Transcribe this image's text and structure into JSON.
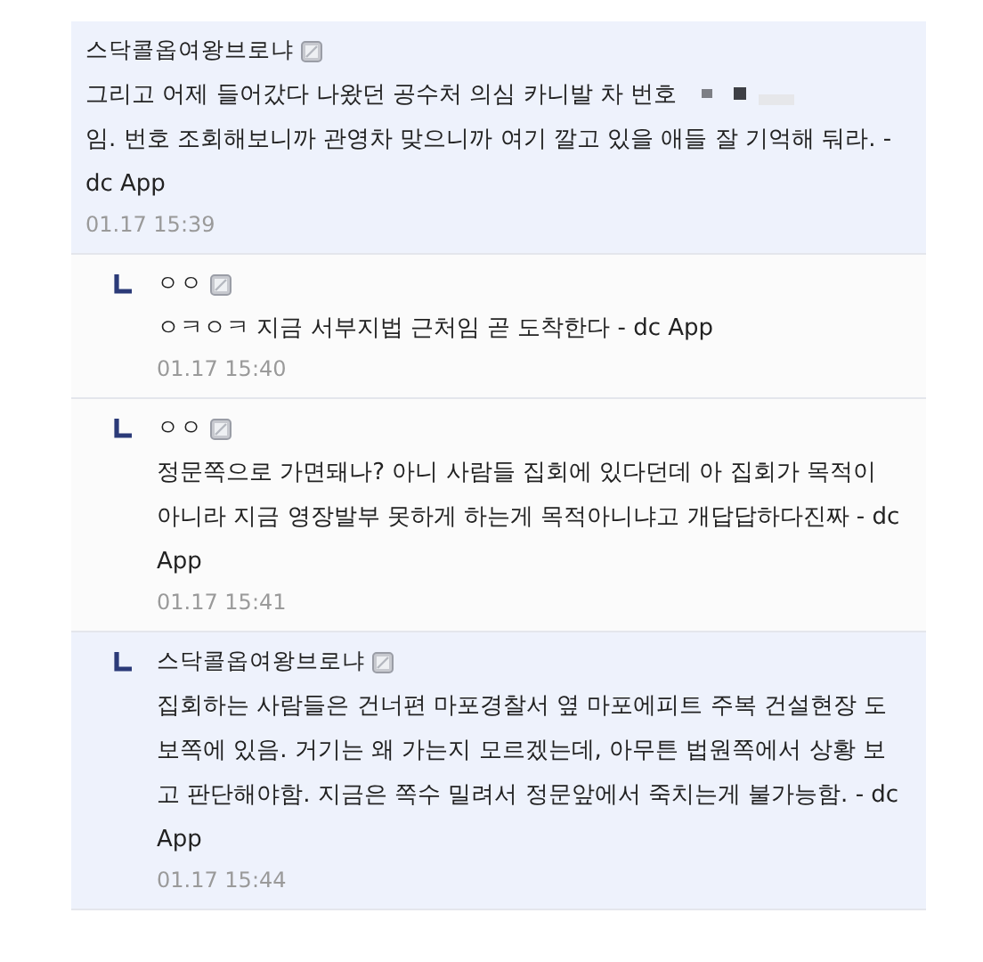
{
  "comments": [
    {
      "kind": "comment",
      "highlighted": true,
      "nickname": "스닥콜옵여왕브로냐",
      "body": [
        {
          "kind": "text",
          "text": "그리고 어제 들어갔다 나왔던 공수처 의심 카니발 차 번호"
        },
        {
          "kind": "redaction"
        },
        {
          "kind": "text",
          "text": "임. 번호 조회해보니까 관영차 맞으니까 여기 깔고 있을 애들 잘 기억해 둬라. - dc App"
        }
      ],
      "time": "01.17 15:39"
    },
    {
      "kind": "reply",
      "highlighted": false,
      "nickname": "ㅇㅇ",
      "body": [
        {
          "kind": "text",
          "text": "ㅇㅋㅇㅋ 지금 서부지법 근처임 곧 도착한다 - dc App"
        }
      ],
      "time": "01.17 15:40"
    },
    {
      "kind": "reply",
      "highlighted": false,
      "nickname": "ㅇㅇ",
      "body": [
        {
          "kind": "text",
          "text": "정문쪽으로 가면돼나? 아니 사람들 집회에 있다던데 아 집회가 목적이 아니라 지금 영장발부 못하게 하는게 목적아니냐고 개답답하다진짜 - dc App"
        }
      ],
      "time": "01.17 15:41"
    },
    {
      "kind": "reply",
      "highlighted": true,
      "nickname": "스닥콜옵여왕브로냐",
      "body": [
        {
          "kind": "text",
          "text": "집회하는 사람들은 건너편 마포경찰서 옆 마포에피트 주복 건설현장 도보쪽에 있음. 거기는 왜 가는지 모르겠는데, 아무튼 법원쪽에서 상황 보고 판단해야함. 지금은 쪽수 밀려서 정문앞에서 죽치는게 불가능함. - dc App"
        }
      ],
      "time": "01.17 15:44"
    }
  ]
}
